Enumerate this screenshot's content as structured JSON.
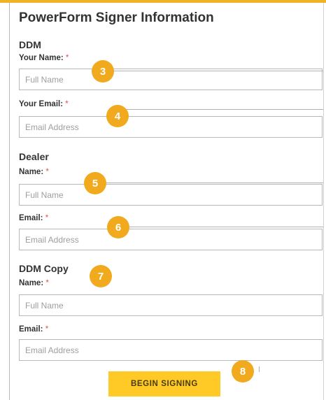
{
  "form": {
    "title": "PowerForm Signer Information",
    "required_mark": "*",
    "ddm": {
      "heading": "DDM",
      "name_label": "Your Name:",
      "name_placeholder": "Full Name",
      "email_label": "Your Email:",
      "email_placeholder": "Email Address"
    },
    "dealer": {
      "heading": "Dealer",
      "name_label": "Name:",
      "name_placeholder": "Full Name",
      "email_label": "Email:",
      "email_placeholder": "Email Address"
    },
    "ddm_copy": {
      "heading": "DDM Copy",
      "name_label": "Name:",
      "name_placeholder": "Full Name",
      "email_label": "Email:",
      "email_placeholder": "Email Address"
    },
    "submit_label": "BEGIN SIGNING"
  },
  "callouts": [
    "3",
    "4",
    "5",
    "6",
    "7",
    "8"
  ],
  "colors": {
    "accent": "#f0b323",
    "callout": "#f1a91e",
    "button": "#ffc926",
    "required": "#d9534f"
  }
}
